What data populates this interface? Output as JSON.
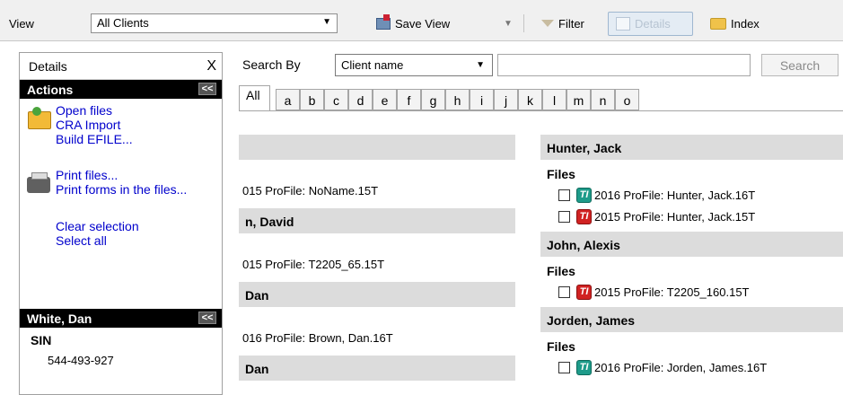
{
  "toolbar": {
    "view_label": "View",
    "view_value": "All Clients",
    "save_view_label": "Save View",
    "filter_label": "Filter",
    "details_label": "Details",
    "index_label": "Index"
  },
  "details_panel": {
    "title": "Details",
    "close_symbol": "X",
    "actions_title": "Actions",
    "collapse_symbol": "<<",
    "actions": {
      "open_files": "Open files",
      "cra_import": "CRA Import",
      "build_efile": "Build EFILE...",
      "print_files": "Print files...",
      "print_forms": "Print forms in the files...",
      "clear_selection": "Clear selection",
      "select_all": "Select all"
    },
    "client": {
      "name": "White, Dan",
      "sin_label": "SIN",
      "sin_value": "544-493-927"
    }
  },
  "search": {
    "label": "Search By",
    "field": "Client name",
    "query": "",
    "button": "Search"
  },
  "letter_tabs": [
    "All",
    "a",
    "b",
    "c",
    "d",
    "e",
    "f",
    "g",
    "h",
    "i",
    "j",
    "k",
    "l",
    "m",
    "n",
    "o"
  ],
  "left_column": {
    "groups": [
      {
        "header": "",
        "file": "015 ProFile: NoName.15T"
      },
      {
        "header": "n, David",
        "file": "015 ProFile: T2205_65.15T"
      },
      {
        "header": "Dan",
        "file": "016 ProFile: Brown, Dan.16T"
      },
      {
        "header": "Dan"
      }
    ]
  },
  "right_column": {
    "files_label": "Files",
    "ti_icon_text": "TI",
    "groups": [
      {
        "header": "Hunter, Jack",
        "files": [
          {
            "name": "2016 ProFile: Hunter, Jack.16T",
            "icon": "teal"
          },
          {
            "name": "2015 ProFile: Hunter, Jack.15T",
            "icon": "red"
          }
        ]
      },
      {
        "header": "John, Alexis",
        "files": [
          {
            "name": "2015 ProFile: T2205_160.15T",
            "icon": "red"
          }
        ]
      },
      {
        "header": "Jorden, James",
        "files": [
          {
            "name": "2016 ProFile: Jorden, James.16T",
            "icon": "teal"
          }
        ]
      }
    ]
  }
}
